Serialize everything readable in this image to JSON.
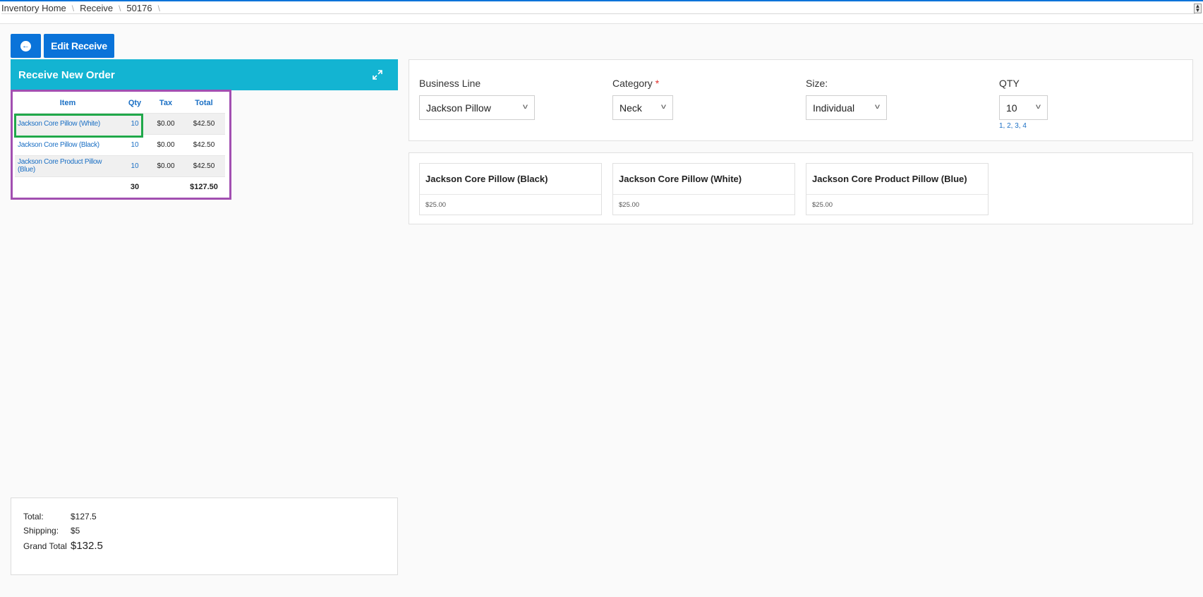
{
  "breadcrumb": [
    "Inventory Home",
    "Receive",
    "50176"
  ],
  "toolbar": {
    "edit_label": "Edit Receive"
  },
  "panel": {
    "title": "Receive New Order"
  },
  "order_table": {
    "headers": {
      "item": "Item",
      "qty": "Qty",
      "tax": "Tax",
      "total": "Total"
    },
    "rows": [
      {
        "item": "Jackson Core Pillow (White)",
        "qty": "10",
        "tax": "$0.00",
        "total": "$42.50"
      },
      {
        "item": "Jackson Core Pillow (Black)",
        "qty": "10",
        "tax": "$0.00",
        "total": "$42.50"
      },
      {
        "item": "Jackson Core Product Pillow (Blue)",
        "qty": "10",
        "tax": "$0.00",
        "total": "$42.50"
      }
    ],
    "totals": {
      "qty": "30",
      "total": "$127.50"
    }
  },
  "summary": {
    "total_label": "Total:",
    "total_value": "$127.5",
    "shipping_label": "Shipping:",
    "shipping_value": "$5",
    "grand_label": "Grand Total",
    "grand_value": "$132.5"
  },
  "filters": {
    "business_line": {
      "label": "Business Line",
      "value": "Jackson Pillow"
    },
    "category": {
      "label": "Category",
      "required_mark": "*",
      "value": "Neck"
    },
    "size": {
      "label": "Size:",
      "value": "Individual"
    },
    "qty": {
      "label": "QTY",
      "value": "10",
      "hint": "1, 2, 3, 4"
    }
  },
  "products": [
    {
      "name": "Jackson Core Pillow (Black)",
      "price": "$25.00"
    },
    {
      "name": "Jackson Core Pillow (White)",
      "price": "$25.00"
    },
    {
      "name": "Jackson Core Product Pillow (Blue)",
      "price": "$25.00"
    }
  ],
  "colors": {
    "primary": "#0a73d9",
    "header": "#13b4d2",
    "purple_highlight": "#a24fb1",
    "green_highlight": "#20a84a"
  },
  "icons": {
    "back": "arrow-left-circle-icon",
    "expand": "expand-icon",
    "dropdown": "chevron-down-icon"
  }
}
